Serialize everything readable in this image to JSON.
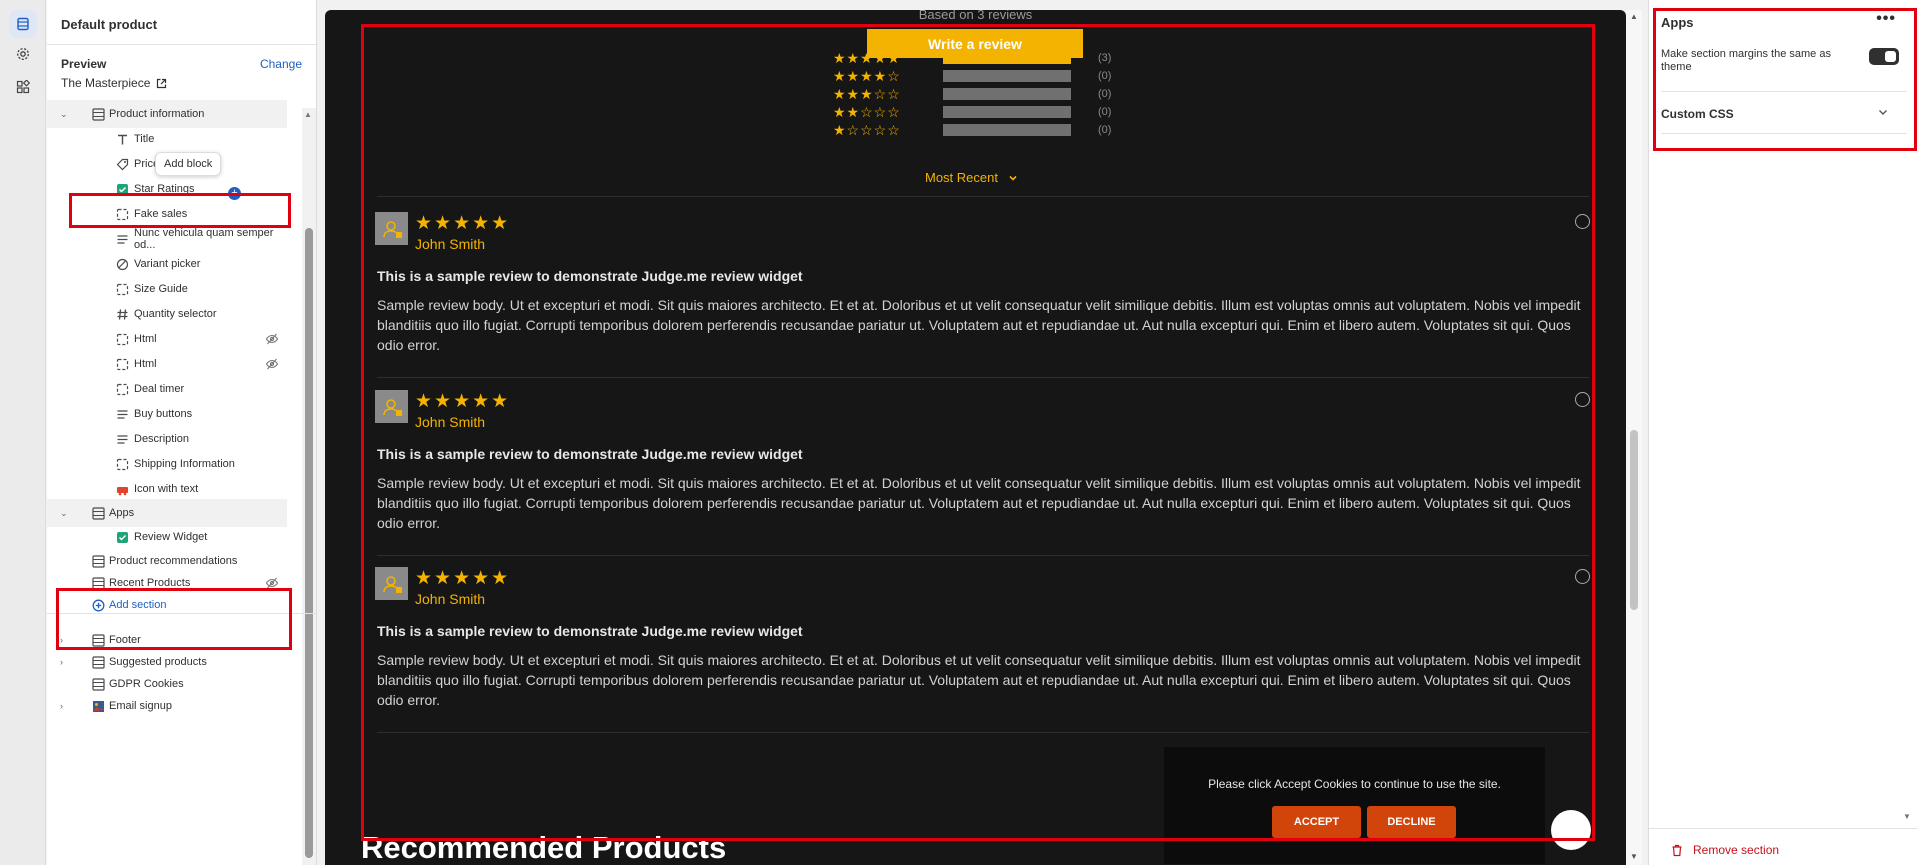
{
  "left_panel": {
    "title": "Default product",
    "preview_label": "Preview",
    "change_label": "Change",
    "preview_theme": "The Masterpiece",
    "tooltip": "Add block",
    "items": [
      {
        "label": "Product information",
        "type": "group",
        "icon": "section-icon"
      },
      {
        "label": "Title",
        "type": "block",
        "icon": "text-icon"
      },
      {
        "label": "Price",
        "type": "block",
        "icon": "price-tag-icon"
      },
      {
        "label": "Star Ratings",
        "type": "block",
        "icon": "app-block-icon"
      },
      {
        "label": "Fake sales",
        "type": "block",
        "icon": "dashed-square-icon"
      },
      {
        "label": "Nunc vehicula quam semper od...",
        "type": "block",
        "icon": "text-align-icon"
      },
      {
        "label": "Variant picker",
        "type": "block",
        "icon": "variant-icon"
      },
      {
        "label": "Size Guide",
        "type": "block",
        "icon": "dashed-square-icon"
      },
      {
        "label": "Quantity selector",
        "type": "block",
        "icon": "hash-icon"
      },
      {
        "label": "Html",
        "type": "block",
        "icon": "dashed-square-icon",
        "hidden": true
      },
      {
        "label": "Html",
        "type": "block",
        "icon": "dashed-square-icon",
        "hidden": true
      },
      {
        "label": "Deal timer",
        "type": "block",
        "icon": "dashed-square-icon"
      },
      {
        "label": "Buy buttons",
        "type": "block",
        "icon": "text-align-icon"
      },
      {
        "label": "Description",
        "type": "block",
        "icon": "text-align-icon"
      },
      {
        "label": "Shipping Information",
        "type": "block",
        "icon": "dashed-square-icon"
      },
      {
        "label": "Icon with text",
        "type": "block",
        "icon": "icon-with-text-icon"
      },
      {
        "label": "Apps",
        "type": "group",
        "icon": "section-icon"
      },
      {
        "label": "Review Widget",
        "type": "block",
        "icon": "app-block-icon"
      },
      {
        "label": "Product recommendations",
        "type": "section",
        "icon": "section-icon"
      },
      {
        "label": "Recent Products",
        "type": "section",
        "icon": "section-icon",
        "hidden": true
      },
      {
        "label": "Add section",
        "type": "add",
        "icon": "plus-circle-icon"
      },
      {
        "label": "Footer",
        "type": "footer",
        "icon": "section-icon"
      },
      {
        "label": "Suggested products",
        "type": "footer",
        "icon": "section-icon"
      },
      {
        "label": "GDPR Cookies",
        "type": "footer",
        "icon": "section-icon"
      },
      {
        "label": "Email signup",
        "type": "footer",
        "icon": "image-icon"
      }
    ]
  },
  "preview": {
    "based_on": "Based on 3 reviews",
    "write_review": "Write a review",
    "histogram": [
      {
        "stars": 5,
        "stars_text": "★★★★★",
        "fill": 1.0,
        "count": "(3)"
      },
      {
        "stars": 4,
        "stars_text": "★★★★☆",
        "fill": 0,
        "count": "(0)"
      },
      {
        "stars": 3,
        "stars_text": "★★★☆☆",
        "fill": 0,
        "count": "(0)"
      },
      {
        "stars": 2,
        "stars_text": "★★☆☆☆",
        "fill": 0,
        "count": "(0)"
      },
      {
        "stars": 1,
        "stars_text": "★☆☆☆☆",
        "fill": 0,
        "count": "(0)"
      }
    ],
    "sort_label": "Most Recent",
    "reviews": [
      {
        "stars": "★★★★★",
        "name": "John Smith",
        "title": "This is a sample review to demonstrate Judge.me review widget",
        "body": "Sample review body. Ut et excepturi et modi. Sit quis maiores architecto. Et et at. Doloribus et ut velit consequatur velit similique debitis. Illum est voluptas omnis aut voluptatem. Nobis vel impedit blanditiis quo illo fugiat. Corrupti temporibus dolorem perferendis recusandae pariatur ut. Voluptatem aut et repudiandae ut. Aut nulla excepturi qui. Enim et libero autem. Voluptates sit qui. Quos odio error."
      },
      {
        "stars": "★★★★★",
        "name": "John Smith",
        "title": "This is a sample review to demonstrate Judge.me review widget",
        "body": "Sample review body. Ut et excepturi et modi. Sit quis maiores architecto. Et et at. Doloribus et ut velit consequatur velit similique debitis. Illum est voluptas omnis aut voluptatem. Nobis vel impedit blanditiis quo illo fugiat. Corrupti temporibus dolorem perferendis recusandae pariatur ut. Voluptatem aut et repudiandae ut. Aut nulla excepturi qui. Enim et libero autem. Voluptates sit qui. Quos odio error."
      },
      {
        "stars": "★★★★★",
        "name": "John Smith",
        "title": "This is a sample review to demonstrate Judge.me review widget",
        "body": "Sample review body. Ut et excepturi et modi. Sit quis maiores architecto. Et et at. Doloribus et ut velit consequatur velit similique debitis. Illum est voluptas omnis aut voluptatem. Nobis vel impedit blanditiis quo illo fugiat. Corrupti temporibus dolorem perferendis recusandae pariatur ut. Voluptatem aut et repudiandae ut. Aut nulla excepturi qui. Enim et libero autem. Voluptates sit qui. Quos odio error."
      }
    ],
    "recommended_title": "Recommended Products",
    "cookie_text": "Please click Accept Cookies to continue to use the site.",
    "accept_label": "ACCEPT",
    "decline_label": "DECLINE"
  },
  "right_panel": {
    "title": "Apps",
    "more_label": "•••",
    "margin_label": "Make section margins the same as theme",
    "margin_toggle_on": true,
    "custom_css_label": "Custom CSS",
    "remove_label": "Remove section"
  },
  "colors": {
    "accent_star": "#f3b300",
    "link_blue": "#1f5fc4",
    "cookie_button": "#d1440a",
    "annotation_red": "#e0000f",
    "remove_red": "#c4121a"
  }
}
